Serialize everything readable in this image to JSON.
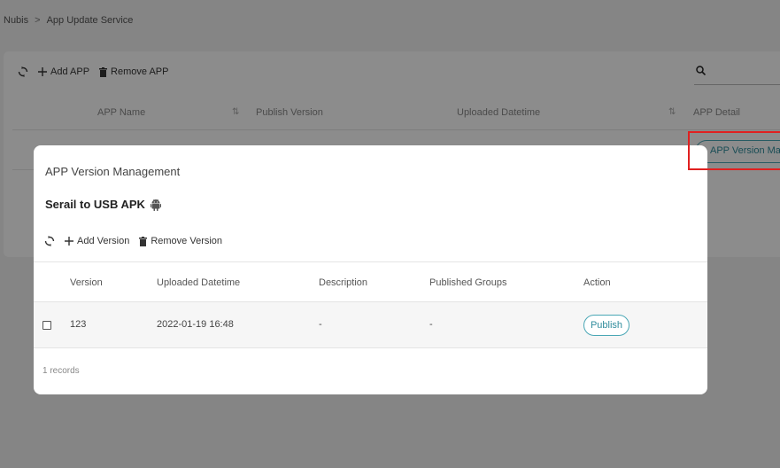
{
  "breadcrumb": {
    "root": "Nubis",
    "separator": ">",
    "current": "App Update Service"
  },
  "toolbar": {
    "add_label": "Add APP",
    "remove_label": "Remove APP"
  },
  "table": {
    "headers": {
      "name": "APP Name",
      "version": "Publish Version",
      "datetime": "Uploaded Datetime",
      "detail": "APP Detail"
    },
    "detail_button": "APP Version Management"
  },
  "modal": {
    "title": "APP Version Management",
    "app_name": "Serail to USB APK",
    "toolbar": {
      "add_label": "Add Version",
      "remove_label": "Remove Version"
    },
    "headers": {
      "version": "Version",
      "datetime": "Uploaded Datetime",
      "description": "Description",
      "groups": "Published Groups",
      "action": "Action"
    },
    "rows": [
      {
        "version": "123",
        "datetime": "2022-01-19 16:48",
        "description": "-",
        "groups": "-",
        "action": "Publish"
      }
    ],
    "records": "1 records"
  },
  "colors": {
    "accent": "#2f8c9c",
    "highlight": "#e02020"
  }
}
